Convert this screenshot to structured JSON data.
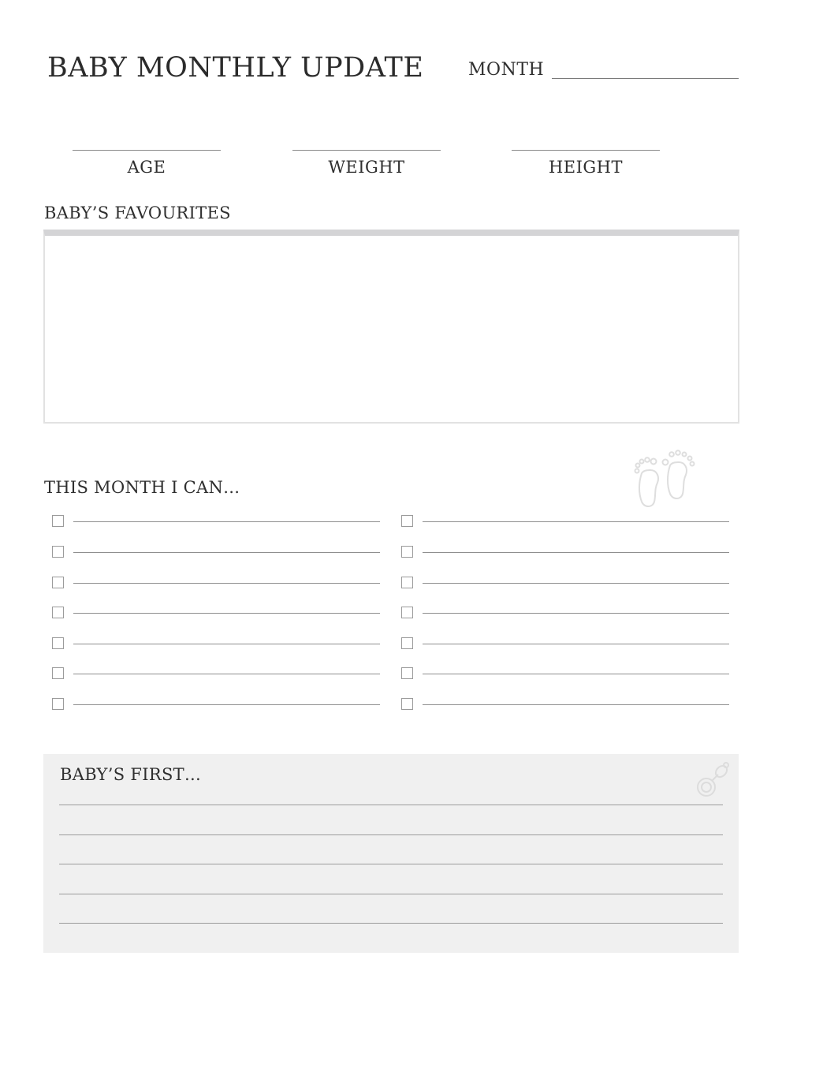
{
  "header": {
    "title": "BABY MONTHLY UPDATE",
    "month_label": "MONTH"
  },
  "stats": {
    "age_label": "AGE",
    "weight_label": "WEIGHT",
    "height_label": "HEIGHT"
  },
  "favourites": {
    "label": "BABY’S FAVOURITES"
  },
  "milestones": {
    "label": "THIS MONTH I CAN…",
    "left_items": 7,
    "right_items": 7,
    "icon": "baby-feet-icon"
  },
  "firsts": {
    "label": "BABY’S FIRST…",
    "lines": 5,
    "icon": "pacifier-icon"
  },
  "colors": {
    "text": "#2f2f2f",
    "line": "#8f8f8f",
    "box_fill": "#f0f0f0",
    "fav_top_bar": "#d4d4d6"
  }
}
